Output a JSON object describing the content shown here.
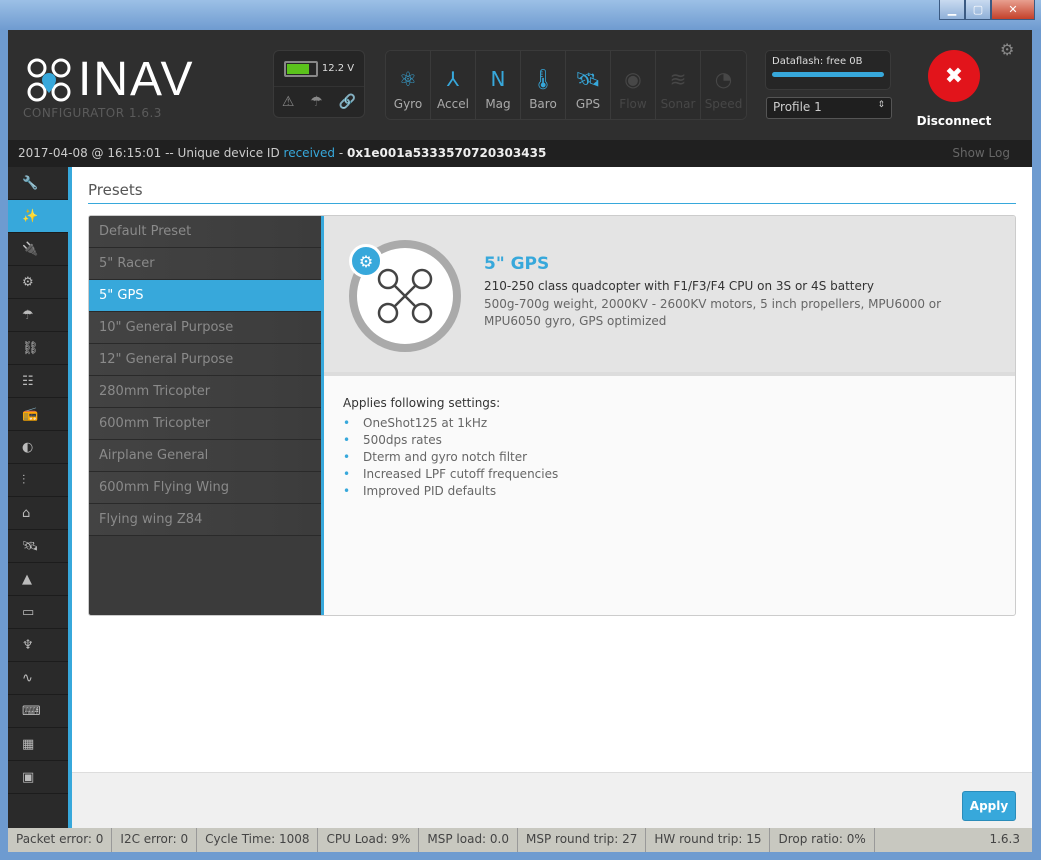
{
  "app": {
    "logo_text": "INAV",
    "subtitle": "CONFIGURATOR  1.6.3"
  },
  "battery": {
    "voltage": "12.2 V",
    "level_percent": 80
  },
  "sensors": [
    {
      "label": "Gyro",
      "icon": "atom-icon",
      "active": true,
      "glyph": "⚛"
    },
    {
      "label": "Accel",
      "icon": "axes-icon",
      "active": true,
      "glyph": "⅄"
    },
    {
      "label": "Mag",
      "icon": "compass-n-icon",
      "active": true,
      "glyph": "N"
    },
    {
      "label": "Baro",
      "icon": "thermometer-icon",
      "active": true,
      "glyph": "🌡"
    },
    {
      "label": "GPS",
      "icon": "satellite-icon",
      "active": true,
      "glyph": "🛰"
    },
    {
      "label": "Flow",
      "icon": "flow-icon",
      "active": false,
      "glyph": "◉"
    },
    {
      "label": "Sonar",
      "icon": "sonar-icon",
      "active": false,
      "glyph": "≋"
    },
    {
      "label": "Speed",
      "icon": "speedometer-icon",
      "active": false,
      "glyph": "◔"
    }
  ],
  "dataflash": {
    "label": "Dataflash: free 0B"
  },
  "profile": {
    "selected": "Profile 1"
  },
  "disconnect": {
    "label": "Disconnect"
  },
  "log": {
    "prefix": "2017-04-08 @ 16:15:01 -- Unique device ID ",
    "highlight": "received",
    "sep": " - ",
    "device_id": "0x1e001a5333570720303435",
    "show_log": "Show Log"
  },
  "sidebar": [
    "wrench-icon",
    "wand-icon",
    "plug-icon",
    "gear-icon",
    "parachute-icon",
    "network-icon",
    "tree-icon",
    "radio-icon",
    "toggles-icon",
    "sliders-icon",
    "pot-icon",
    "satellite-icon",
    "bottle-icon",
    "osd-icon",
    "led-icon",
    "pulse-icon",
    "keyboard-icon",
    "chip-icon",
    "terminal-icon"
  ],
  "sidebar_active": 1,
  "presets": {
    "title": "Presets",
    "items": [
      "Default Preset",
      "5\" Racer",
      "5\" GPS",
      "10\" General Purpose",
      "12\" General Purpose",
      "280mm Tricopter",
      "600mm Tricopter",
      "Airplane General",
      "600mm Flying Wing",
      "Flying wing Z84"
    ],
    "selected": 2,
    "detail": {
      "name": "5\" GPS",
      "description": "210-250 class quadcopter with F1/F3/F4 CPU on 3S or 4S battery",
      "details": "500g-700g weight, 2000KV - 2600KV motors, 5 inch propellers, MPU6000 or MPU6050 gyro, GPS optimized"
    },
    "settings_heading": "Applies following settings:",
    "settings": [
      "OneShot125 at 1kHz",
      "500dps rates",
      "Dterm and gyro notch filter",
      "Increased LPF cutoff frequencies",
      "Improved PID defaults"
    ]
  },
  "apply_label": "Apply",
  "footer": [
    "Packet error: 0",
    "I2C error: 0",
    "Cycle Time: 1008",
    "CPU Load: 9%",
    "MSP load: 0.0",
    "MSP round trip: 27",
    "HW round trip: 15",
    "Drop ratio: 0%"
  ],
  "footer_version": "1.6.3",
  "colors": {
    "accent": "#37a8db",
    "disconnect": "#e2141b",
    "battery": "#5bc21c"
  }
}
